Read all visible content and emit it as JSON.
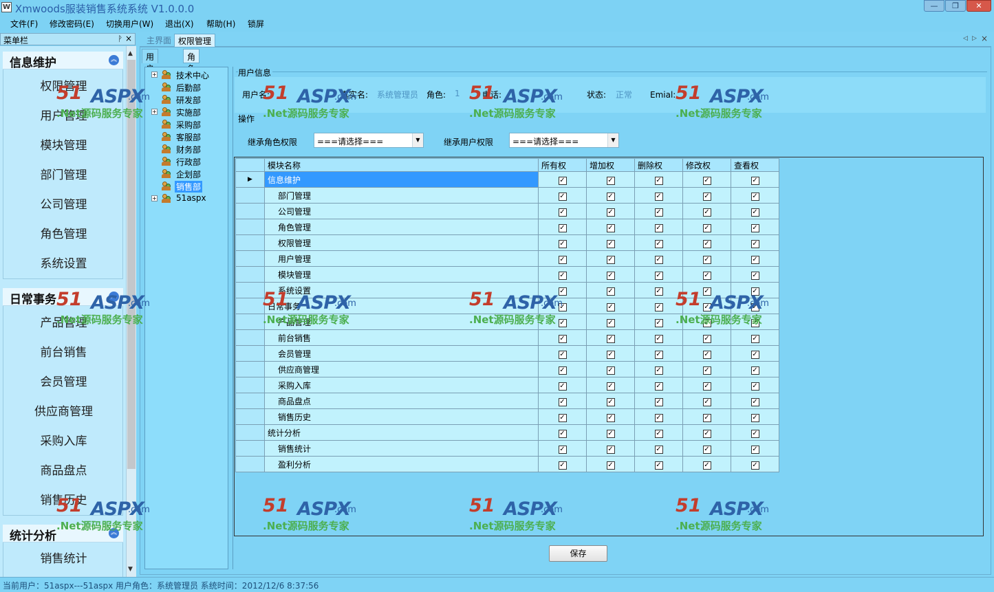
{
  "window": {
    "title": "Xmwoods服装销售系统系统 V1.0.0.0",
    "min": "—",
    "max": "❐",
    "close": "✕"
  },
  "menu": [
    "文件(F)",
    "修改密码(E)",
    "切换用户(W)",
    "退出(X)",
    "帮助(H)",
    "锁屏"
  ],
  "sidebar": {
    "title": "菜单栏",
    "groups": [
      {
        "title": "信息维护",
        "items": [
          "权限管理",
          "用户管理",
          "模块管理",
          "部门管理",
          "公司管理",
          "角色管理",
          "系统设置"
        ]
      },
      {
        "title": "日常事务",
        "items": [
          "产品管理",
          "前台销售",
          "会员管理",
          "供应商管理",
          "采购入库",
          "商品盘点",
          "销售历史"
        ]
      },
      {
        "title": "统计分析",
        "items": [
          "销售统计"
        ]
      }
    ]
  },
  "tabs": [
    "主界面",
    "权限管理"
  ],
  "subtabs": [
    "用户权限",
    "角色权限"
  ],
  "tree": {
    "nodes": [
      "技术中心",
      "后勤部",
      "研发部",
      "实施部",
      "采购部",
      "客服部",
      "财务部",
      "行政部",
      "企划部",
      "销售部",
      "51aspx"
    ],
    "selected": "销售部"
  },
  "user_info": {
    "section": "用户信息",
    "username_label": "用户名:",
    "realname_label": "真实名:",
    "realname_value": "系统管理员",
    "role_label": "角色:",
    "role_value": "1",
    "phone_label": "电话:",
    "status_label": "状态:",
    "status_value": "正常",
    "email_label": "Emial:"
  },
  "operations": {
    "section": "操作",
    "inherit_role_label": "继承角色权限",
    "inherit_role_value": "===请选择===",
    "inherit_user_label": "继承用户权限",
    "inherit_user_value": "===请选择==="
  },
  "grid": {
    "columns": [
      "模块名称",
      "所有权",
      "增加权",
      "删除权",
      "修改权",
      "查看权"
    ],
    "rows": [
      {
        "name": "信息维护",
        "child": false
      },
      {
        "name": "部门管理",
        "child": true
      },
      {
        "name": "公司管理",
        "child": true
      },
      {
        "name": "角色管理",
        "child": true
      },
      {
        "name": "权限管理",
        "child": true
      },
      {
        "name": "用户管理",
        "child": true
      },
      {
        "name": "模块管理",
        "child": true
      },
      {
        "name": "系统设置",
        "child": true
      },
      {
        "name": "日常事务",
        "child": false
      },
      {
        "name": "产品管理",
        "child": true
      },
      {
        "name": "前台销售",
        "child": true
      },
      {
        "name": "会员管理",
        "child": true
      },
      {
        "name": "供应商管理",
        "child": true
      },
      {
        "name": "采购入库",
        "child": true
      },
      {
        "name": "商品盘点",
        "child": true
      },
      {
        "name": "销售历史",
        "child": true
      },
      {
        "name": "统计分析",
        "child": false
      },
      {
        "name": "销售统计",
        "child": true
      },
      {
        "name": "盈利分析",
        "child": true
      }
    ],
    "current_row_marker": "▶",
    "check_glyph": "✓"
  },
  "save_label": "保存",
  "status": "当前用户：51aspx---51aspx  用户角色：系统管理员  系统时间：2012/12/6 8:37:56",
  "watermark": {
    "a": "51",
    "b": "ASPX",
    "c": ".com",
    "d": ".Net源码服务专家"
  },
  "colors": {
    "accent": "#7fd3f5",
    "selection": "#3399ff",
    "grid_cell": "#c1f2fd"
  }
}
